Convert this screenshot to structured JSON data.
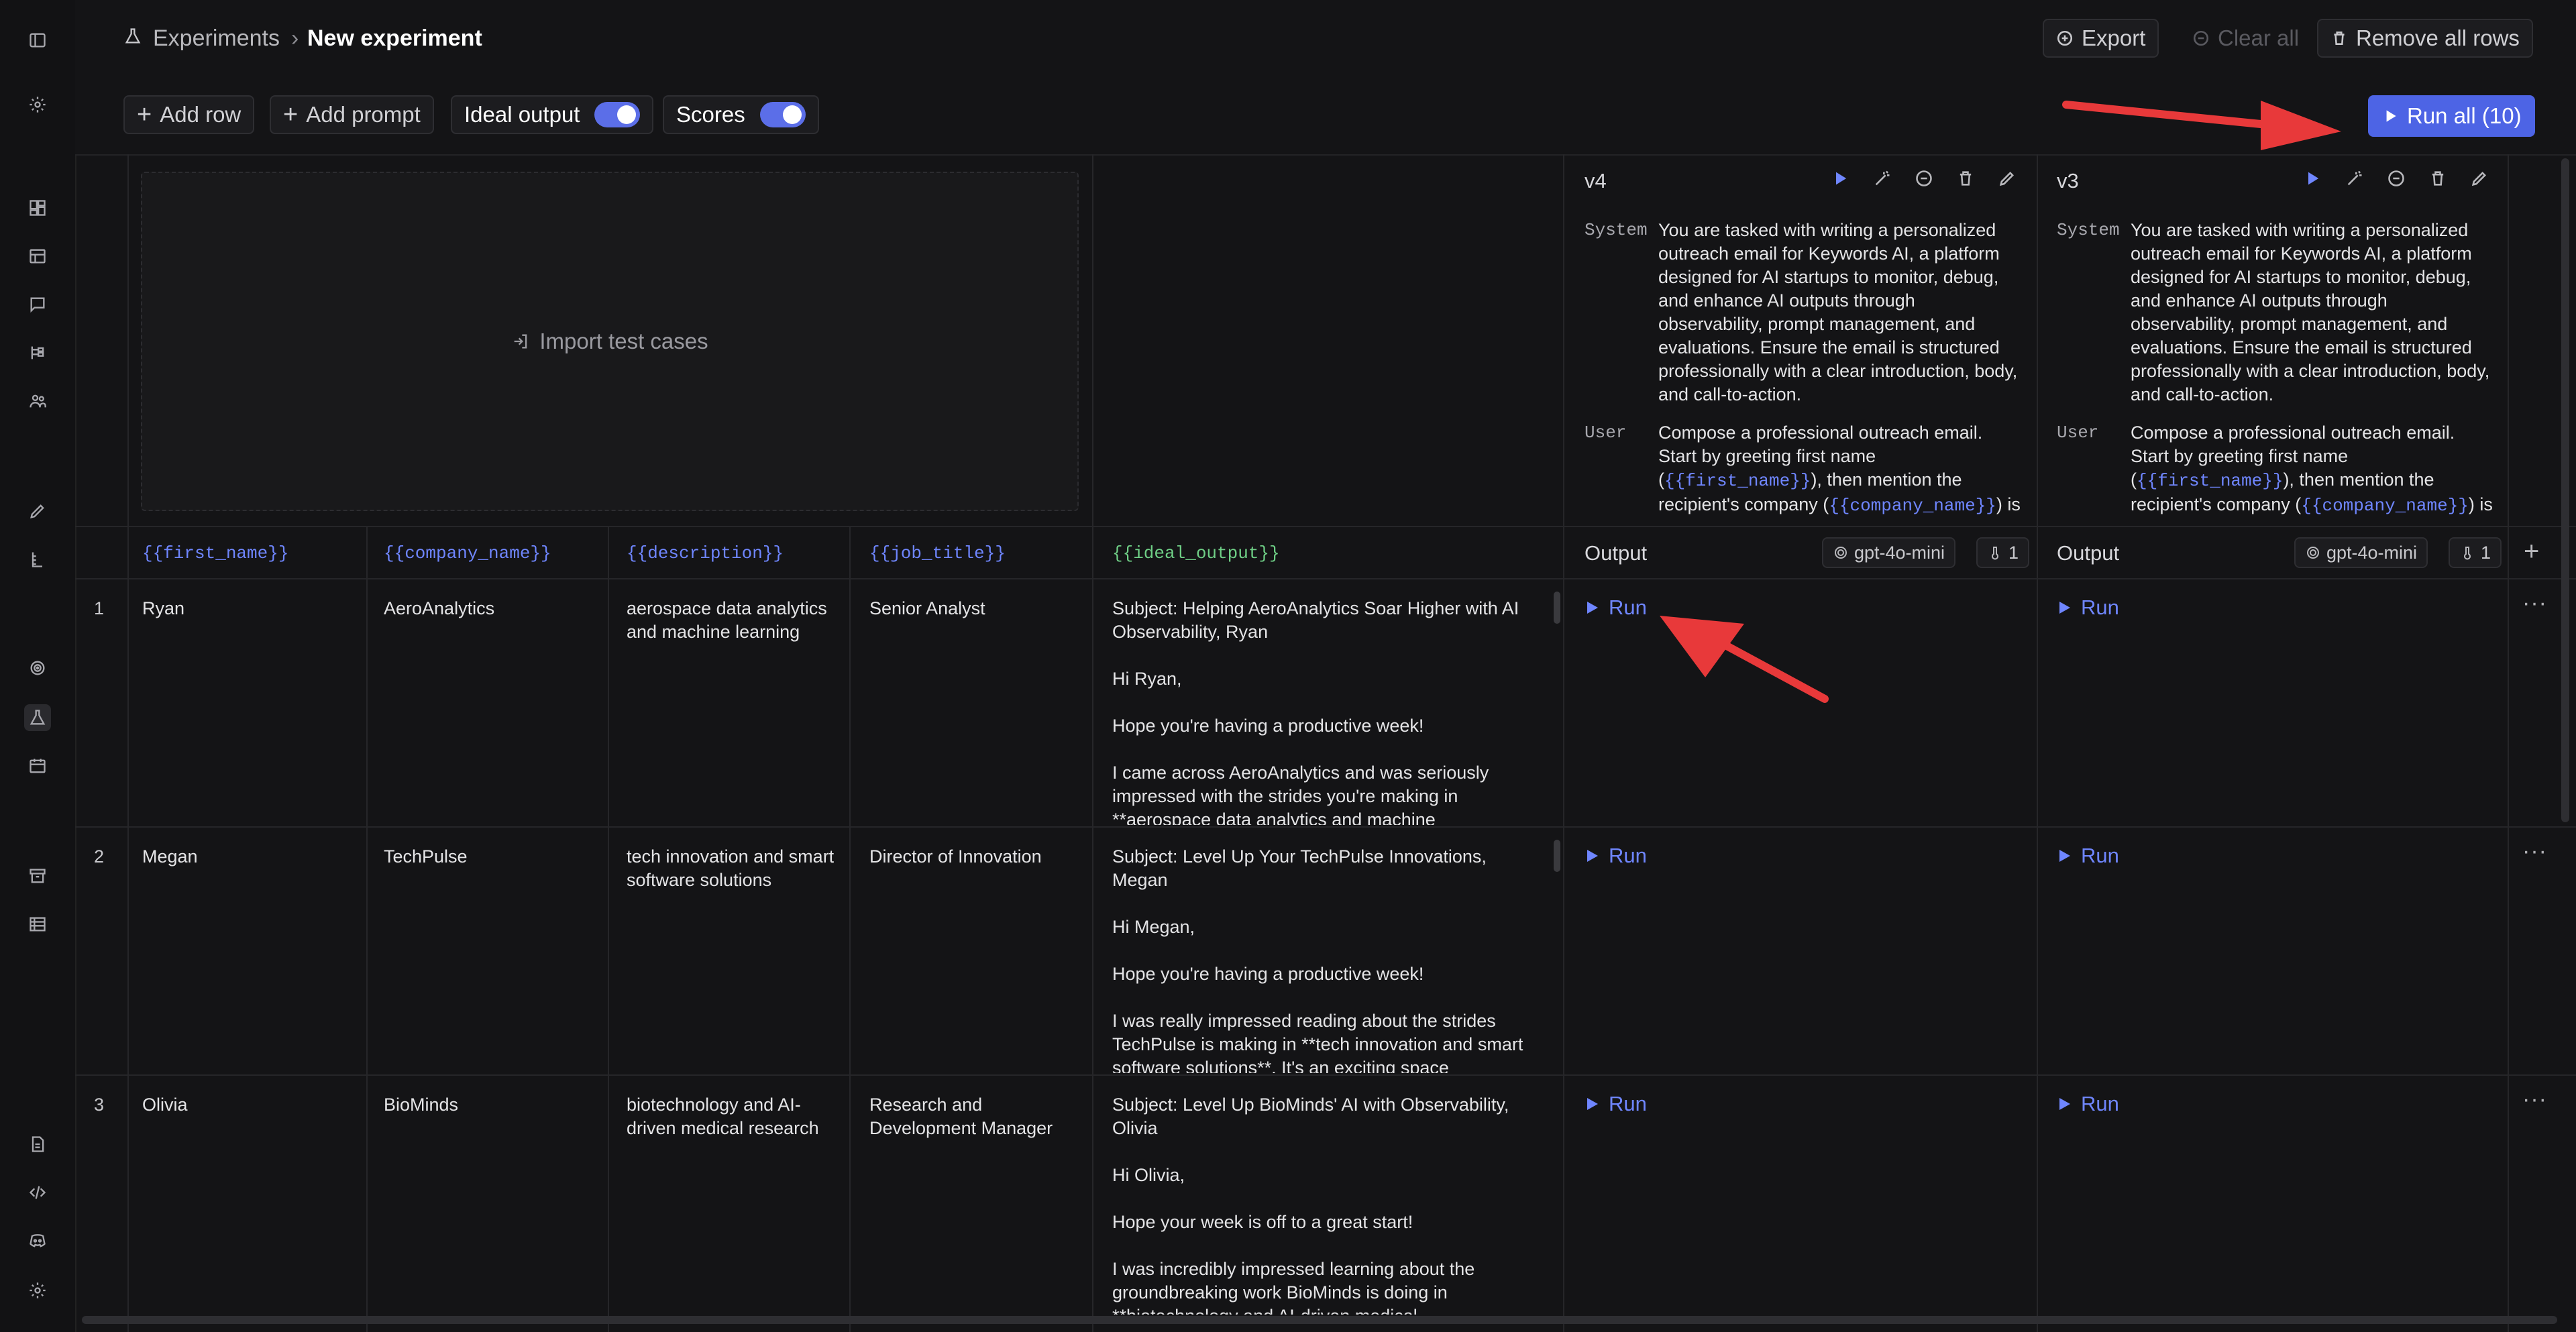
{
  "breadcrumb": {
    "parent": "Experiments",
    "current": "New experiment"
  },
  "header_actions": {
    "export": "Export",
    "clear_all": "Clear all",
    "remove_all_rows": "Remove all rows"
  },
  "toolbar": {
    "add_row": "Add row",
    "add_prompt": "Add prompt",
    "ideal_output_label": "Ideal output",
    "ideal_output_on": true,
    "scores_label": "Scores",
    "scores_on": true,
    "run_all": "Run all (10)"
  },
  "import_test_cases": "Import test cases",
  "columns": {
    "first_name": "{{first_name}}",
    "company_name": "{{company_name}}",
    "description": "{{description}}",
    "job_title": "{{job_title}}",
    "ideal_output": "{{ideal_output}}"
  },
  "prompts": [
    {
      "title": "v4",
      "system_role": "System",
      "system_text": "You are tasked with writing a personalized outreach email for Keywords AI, a platform designed for AI startups to monitor, debug, and enhance AI outputs through observability, prompt management, and evaluations. Ensure the email is structured professionally with a clear introduction, body, and call-to-action.",
      "user_role": "User",
      "user_text_1": "Compose a professional outreach email. Start by greeting first name (",
      "user_var_1": "{{first_name}}",
      "user_text_2": "), then mention the recipient's company (",
      "user_var_2": "{{company_name}}",
      "user_text_3": ") is",
      "output_label": "Output",
      "model": "gpt-4o-mini",
      "temperature": "1"
    },
    {
      "title": "v3",
      "system_role": "System",
      "system_text": "You are tasked with writing a personalized outreach email for Keywords AI, a platform designed for AI startups to monitor, debug, and enhance AI outputs through observability, prompt management, and evaluations. Ensure the email is structured professionally with a clear introduction, body, and call-to-action.",
      "user_role": "User",
      "user_text_1": "Compose a professional outreach email. Start by greeting first name (",
      "user_var_1": "{{first_name}}",
      "user_text_2": "), then mention the recipient's company (",
      "user_var_2": "{{company_name}}",
      "user_text_3": ") is",
      "output_label": "Output",
      "model": "gpt-4o-mini",
      "temperature": "1"
    }
  ],
  "run_label": "Run",
  "row_menu": "···",
  "rows": [
    {
      "num": "1",
      "first_name": "Ryan",
      "company_name": "AeroAnalytics",
      "description": "aerospace data analytics and machine learning",
      "job_title": "Senior Analyst",
      "ideal_output": "Subject: Helping AeroAnalytics Soar Higher with AI Observability, Ryan\n\nHi Ryan,\n\nHope you're having a productive week!\n\nI came across AeroAnalytics and was seriously impressed with the strides you're making in **aerospace data analytics and machine"
    },
    {
      "num": "2",
      "first_name": "Megan",
      "company_name": "TechPulse",
      "description": "tech innovation and smart software solutions",
      "job_title": "Director of Innovation",
      "ideal_output": "Subject: Level Up Your TechPulse Innovations, Megan\n\nHi Megan,\n\nHope you're having a productive week!\n\nI was really impressed reading about the strides TechPulse is making in **tech innovation and smart software solutions**. It's an exciting space"
    },
    {
      "num": "3",
      "first_name": "Olivia",
      "company_name": "BioMinds",
      "description": "biotechnology and AI-driven medical research",
      "job_title": "Research and Development Manager",
      "ideal_output": "Subject: Level Up BioMinds' AI with Observability, Olivia\n\nHi Olivia,\n\nHope your week is off to a great start!\n\nI was incredibly impressed learning about the groundbreaking work BioMinds is doing in **biotechnology and AI-driven medical"
    }
  ],
  "colors": {
    "accent": "#5b6ee8",
    "annotation": "#e8393a"
  }
}
